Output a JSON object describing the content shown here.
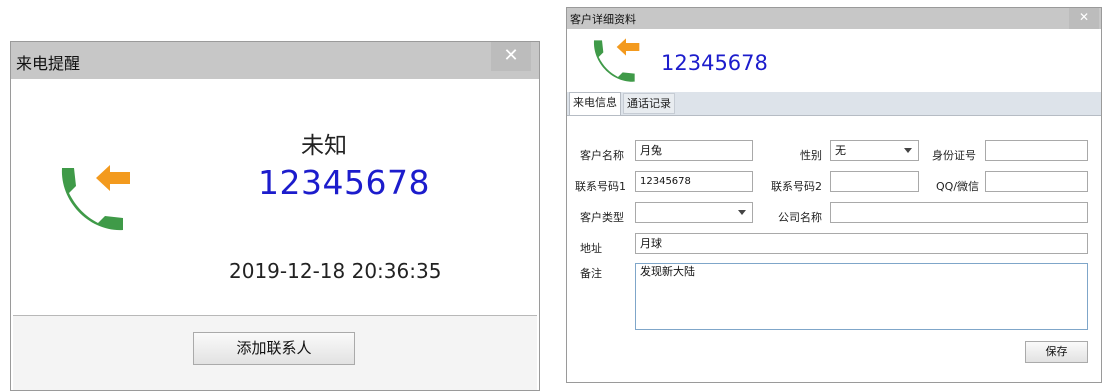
{
  "incoming_call_popup": {
    "title": "来电提醒",
    "caller_name": "未知",
    "phone_number": "12345678",
    "call_time": "2019-12-18 20:36:35",
    "add_contact_label": "添加联系人",
    "close_label": "✕"
  },
  "customer_detail": {
    "title": "客户详细资料",
    "close_label": "✕",
    "phone_number": "12345678",
    "tabs": [
      {
        "label": "来电信息",
        "active": true
      },
      {
        "label": "通话记录",
        "active": false
      }
    ],
    "form": {
      "customer_name_label": "客户名称",
      "customer_name_value": "月兔",
      "gender_label": "性别",
      "gender_value": "无",
      "id_number_label": "身份证号",
      "id_number_value": "",
      "phone1_label": "联系号码1",
      "phone1_value": "12345678",
      "phone2_label": "联系号码2",
      "phone2_value": "",
      "qq_wechat_label": "QQ/微信",
      "qq_wechat_value": "",
      "customer_type_label": "客户类型",
      "customer_type_value": "",
      "company_label": "公司名称",
      "company_value": "",
      "address_label": "地址",
      "address_value": "月球",
      "remark_label": "备注",
      "remark_value": "发现新大陆",
      "save_label": "保存"
    }
  },
  "icons": {
    "call": "incoming-call-icon",
    "close": "close-icon",
    "dropdown": "chevron-down-icon"
  },
  "colors": {
    "phone_green": "#3f9a48",
    "arrow_orange": "#f39a1e",
    "number_blue": "#1c1ccc",
    "titlebar": "#c7c7c7"
  }
}
